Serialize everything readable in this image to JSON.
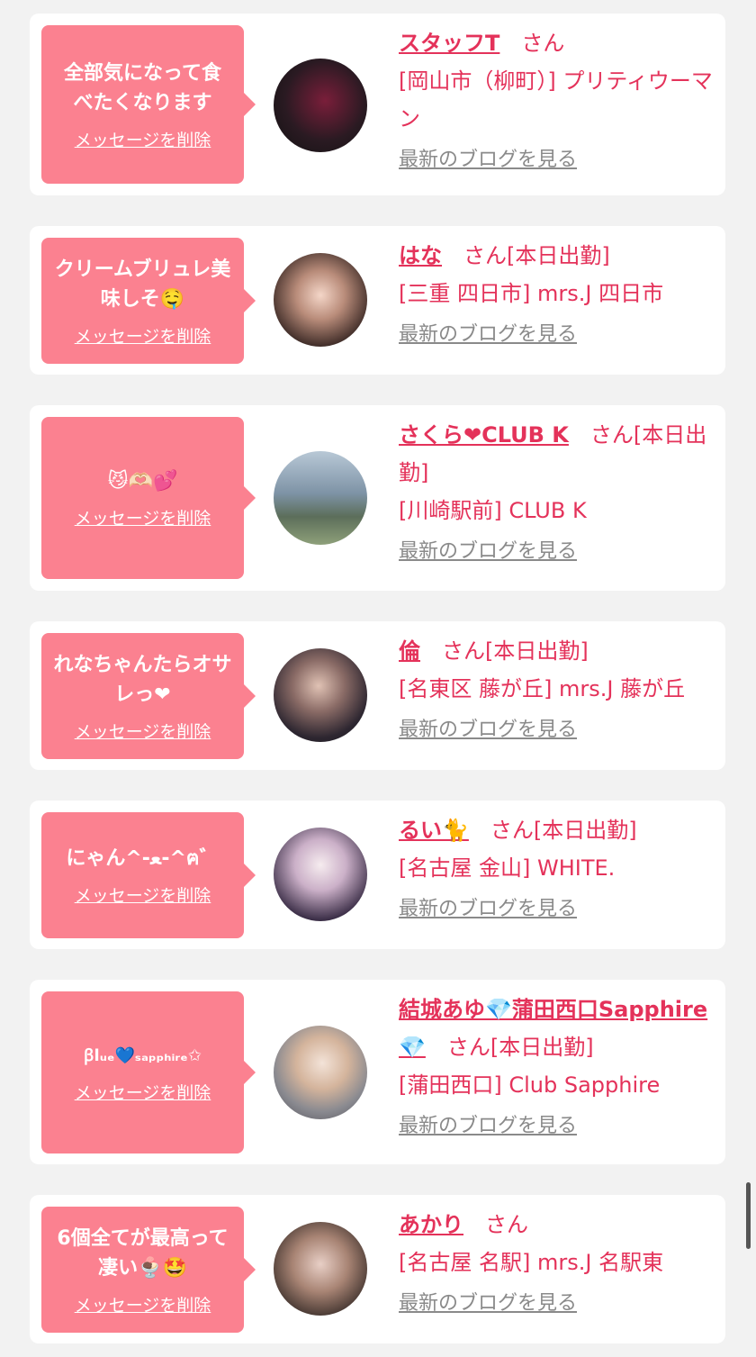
{
  "common": {
    "delete_label": "メッセージを削除",
    "san": "さん",
    "blog_label": "最新のブログを見る"
  },
  "cards": [
    {
      "message": "全部気になって食べたくなります",
      "name": "スタッフT",
      "status": "",
      "shop": "[岡山市（柳町）] プリティウーマン"
    },
    {
      "message": "クリームブリュレ美味しそ🤤",
      "name": "はな",
      "status": "[本日出勤]",
      "shop": "[三重 四日市] mrs.J 四日市"
    },
    {
      "message": "😼🫶🏻💕",
      "name": "さくら❤CLUB K",
      "status": "[本日出勤]",
      "shop": "[川崎駅前] CLUB K"
    },
    {
      "message": "れなちゃんたらオサレっ❤",
      "name": "倫",
      "status": "[本日出勤]",
      "shop": "[名東区 藤が丘] mrs.J 藤が丘"
    },
    {
      "message": "にゃん^-ﻌ-^ฅ゛",
      "name": "るい🐈",
      "status": "[本日出勤]",
      "shop": "[名古屋 金山] WHITE."
    },
    {
      "message": "ꞵlᵤₑ💙ₛₐₚₚₕᵢᵣₑ✩",
      "name": "結城あゆ💎蒲田西口Sapphire💎",
      "status": "[本日出勤]",
      "shop": "[蒲田西口] Club Sapphire"
    },
    {
      "message": "6個全てが最高って凄い🍨🤩",
      "name": "あかり",
      "status": "",
      "shop": "[名古屋 名駅] mrs.J 名駅東"
    }
  ]
}
